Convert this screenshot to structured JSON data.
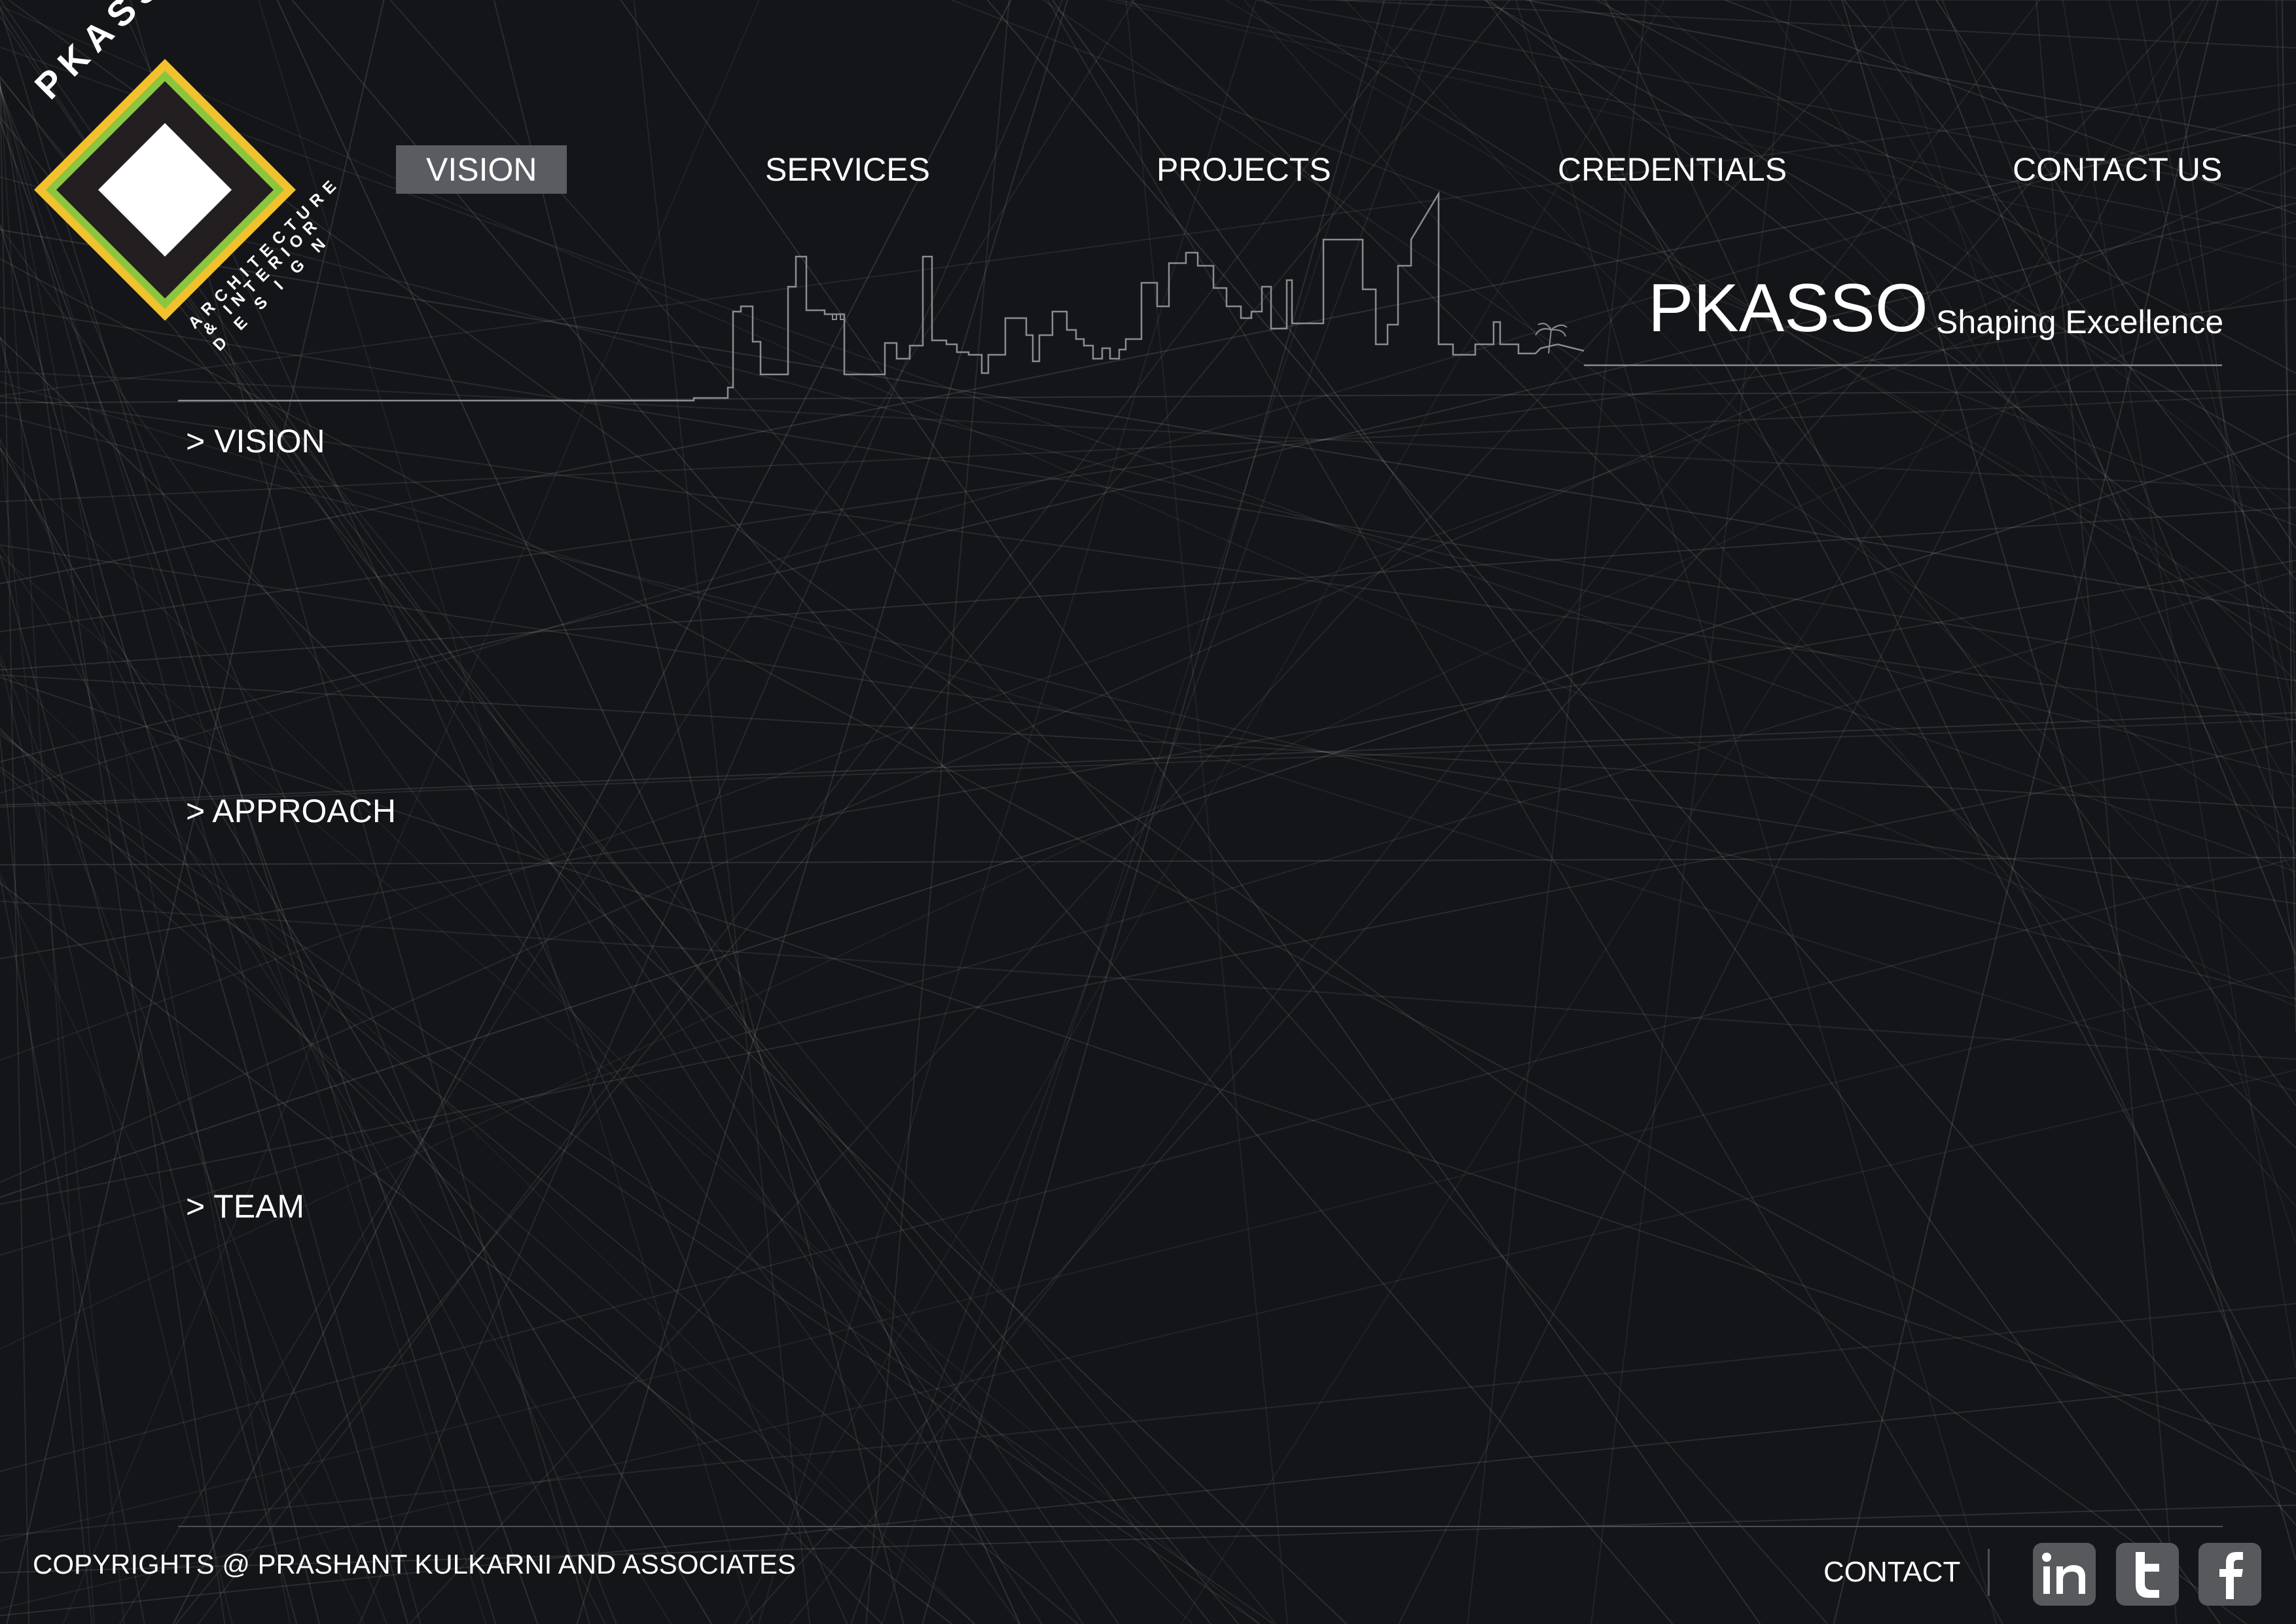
{
  "logo": {
    "wordmark": "PKASSO",
    "subline_1": "ARCHITECTURE",
    "subline_2": "& INTERIOR",
    "subline_3": "D E S I G N",
    "colors": {
      "outer": "#f2c12e",
      "middle": "#8cc63f",
      "inner": "#231f20",
      "center": "#ffffff"
    }
  },
  "nav": {
    "items": [
      {
        "label": "VISION",
        "active": true
      },
      {
        "label": "SERVICES",
        "active": false
      },
      {
        "label": "PROJECTS",
        "active": false
      },
      {
        "label": "CREDENTIALS",
        "active": false
      },
      {
        "label": "CONTACT US",
        "active": false
      }
    ]
  },
  "brand": {
    "name": "PKASSO",
    "tagline": "Shaping Excellence"
  },
  "sections": [
    {
      "title": "> VISION"
    },
    {
      "title": "> APPROACH"
    },
    {
      "title": "> TEAM"
    }
  ],
  "footer": {
    "copyright": "COPYRIGHTS @ PRASHANT KULKARNI AND ASSOCIATES",
    "contact_label": "CONTACT",
    "social": [
      {
        "icon": "linkedin-icon",
        "glyph": "in"
      },
      {
        "icon": "twitter-icon",
        "glyph": "t"
      },
      {
        "icon": "facebook-icon",
        "glyph": "f"
      }
    ]
  },
  "colors": {
    "background": "#141518",
    "text": "#ffffff",
    "nav_active_bg": "#5a5c61",
    "rule": "#4c4e52",
    "social_bg": "#57595d"
  }
}
